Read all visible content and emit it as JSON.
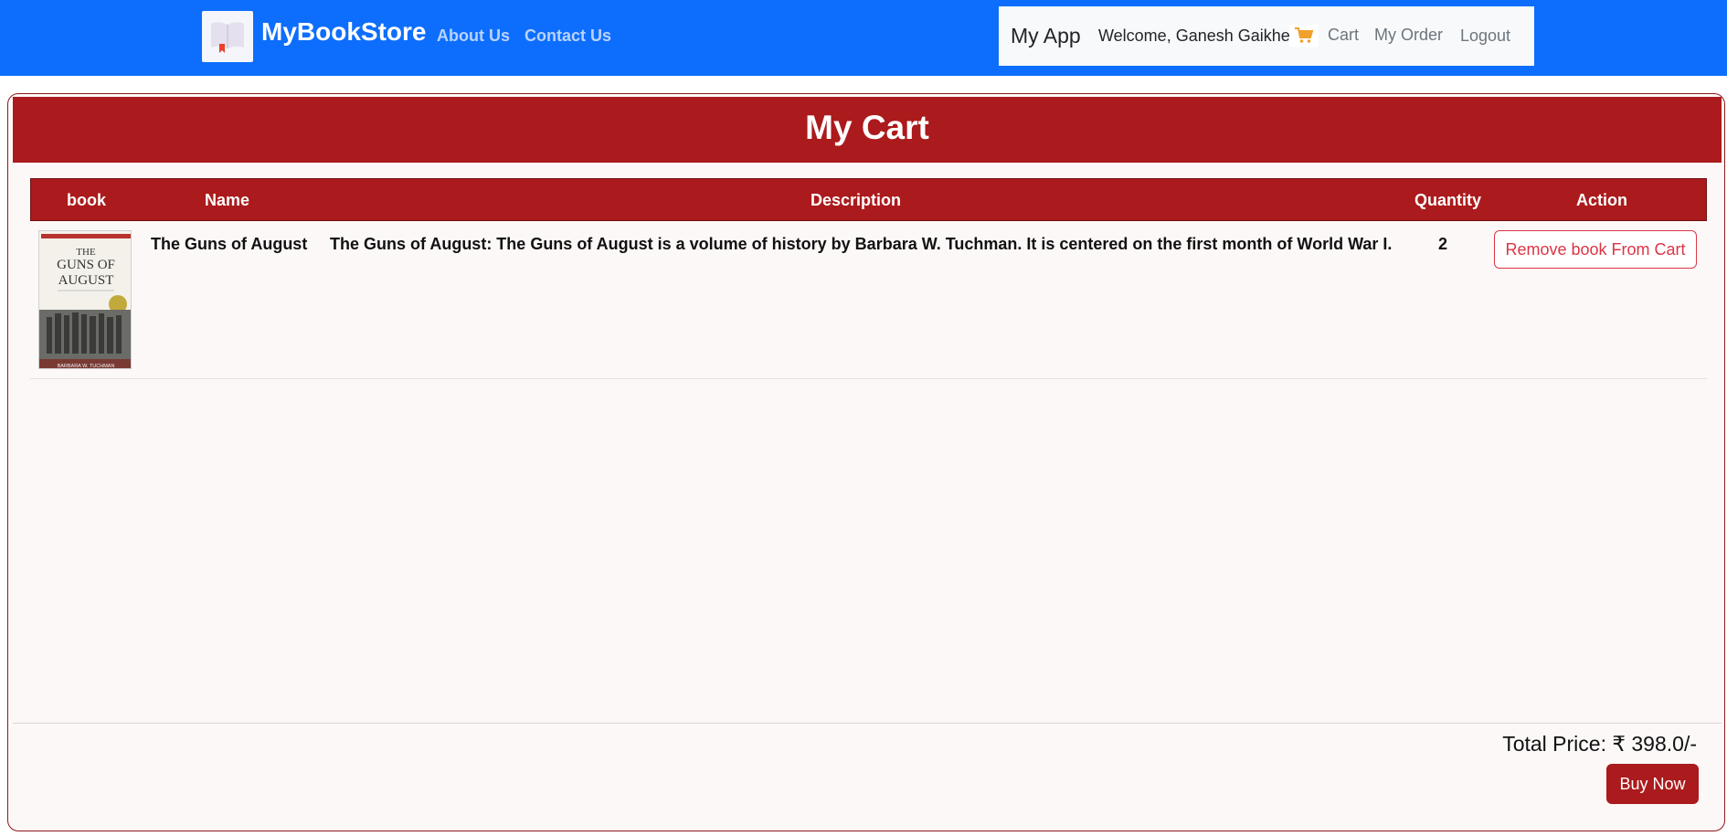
{
  "navbar": {
    "brand": "MyBookStore",
    "links": {
      "about": "About Us",
      "contact": "Contact Us"
    },
    "app_name": "My App",
    "welcome": "Welcome, Ganesh Gaikhe",
    "cart": "Cart",
    "my_order": "My Order",
    "logout": "Logout",
    "accent_color": "#0d6efd"
  },
  "cart": {
    "title": "My Cart",
    "columns": [
      "book",
      "Name",
      "Description",
      "Quantity",
      "Action"
    ],
    "rows": [
      {
        "cover": {
          "title_line1": "THE",
          "title_line2": "GUNS OF",
          "title_line3": "AUGUST",
          "author": "BARBARA W. TUCHMAN"
        },
        "name": "The Guns of August",
        "description": "The Guns of August: The Guns of August is a volume of history by Barbara W. Tuchman. It is centered on the first month of World War I.",
        "quantity": "2",
        "action": "Remove book From Cart"
      }
    ],
    "total": "Total Price: ₹ 398.0/-",
    "buy_label": "Buy Now",
    "theme_color": "#ab1a1c"
  }
}
